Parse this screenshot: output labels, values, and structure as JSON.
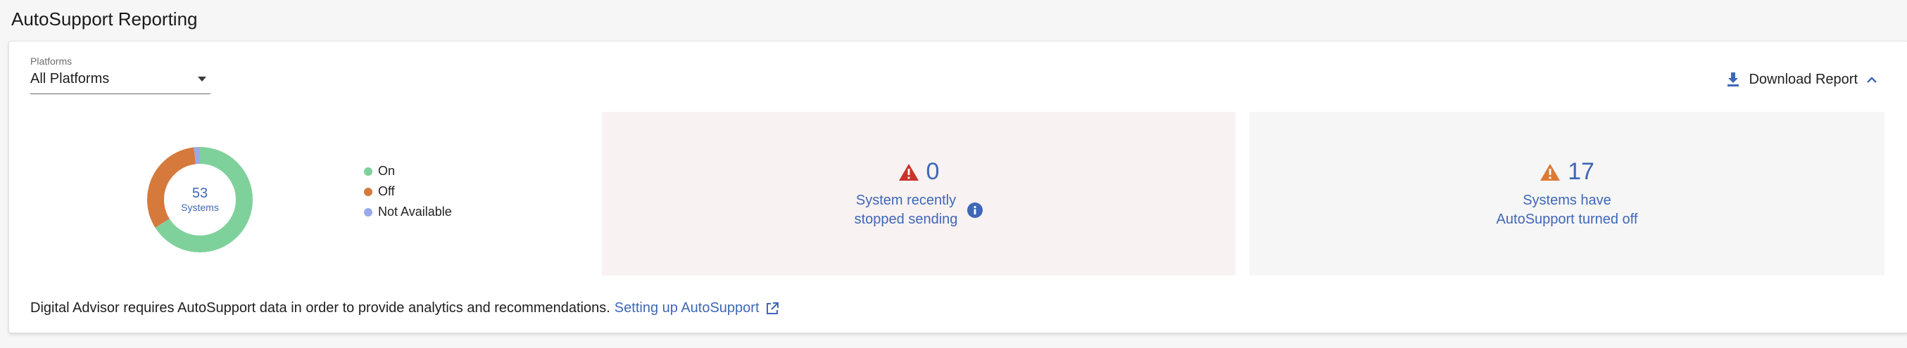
{
  "page": {
    "title": "AutoSupport Reporting"
  },
  "filter": {
    "label": "Platforms",
    "value": "All Platforms"
  },
  "download": {
    "label": "Download Report"
  },
  "donut": {
    "total": "53",
    "unit": "Systems",
    "segments": [
      {
        "name": "On",
        "value": 35,
        "color": "#7fd19c"
      },
      {
        "name": "Off",
        "value": 17,
        "color": "#d57a3c"
      },
      {
        "name": "Not Available",
        "value": 1,
        "color": "#9aa9ea"
      }
    ]
  },
  "legend": [
    {
      "label": "On",
      "color": "#7fd19c"
    },
    {
      "label": "Off",
      "color": "#d57a3c"
    },
    {
      "label": "Not Available",
      "color": "#9aa9ea"
    }
  ],
  "stats": {
    "stopped": {
      "count": "0",
      "line1": "System recently",
      "line2": "stopped sending",
      "icon_color": "#c7342c"
    },
    "off": {
      "count": "17",
      "line1": "Systems have",
      "line2": "AutoSupport turned off",
      "icon_color": "#dc7a34"
    }
  },
  "footer": {
    "text": "Digital Advisor requires AutoSupport data in order to provide analytics and recommendations.",
    "link": "Setting up AutoSupport"
  },
  "colors": {
    "accent": "#3f67b7"
  }
}
